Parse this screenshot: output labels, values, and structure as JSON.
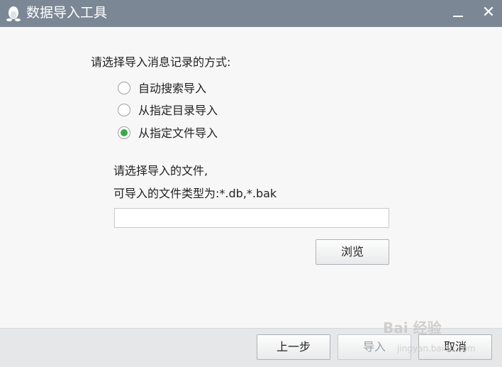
{
  "window": {
    "title": "数据导入工具",
    "icon": "qq-penguin-icon"
  },
  "main": {
    "prompt": "请选择导入消息记录的方式:",
    "options": [
      {
        "label": "自动搜索导入",
        "checked": false
      },
      {
        "label": "从指定目录导入",
        "checked": false
      },
      {
        "label": "从指定文件导入",
        "checked": true
      }
    ],
    "file_label_line1": "请选择导入的文件,",
    "file_label_line2": "可导入的文件类型为:*.db,*.bak",
    "file_path_value": "",
    "browse_label": "浏览"
  },
  "footer": {
    "prev_label": "上一步",
    "import_label": "导入",
    "cancel_label": "取消"
  },
  "watermark": {
    "text": "Bai 经验",
    "sub": "jingyan.baidu.com"
  },
  "colors": {
    "titlebar": "#7b8794",
    "radio_checked": "#3aa84a",
    "background": "#f7f7f7",
    "footer": "#e6e7e8"
  }
}
